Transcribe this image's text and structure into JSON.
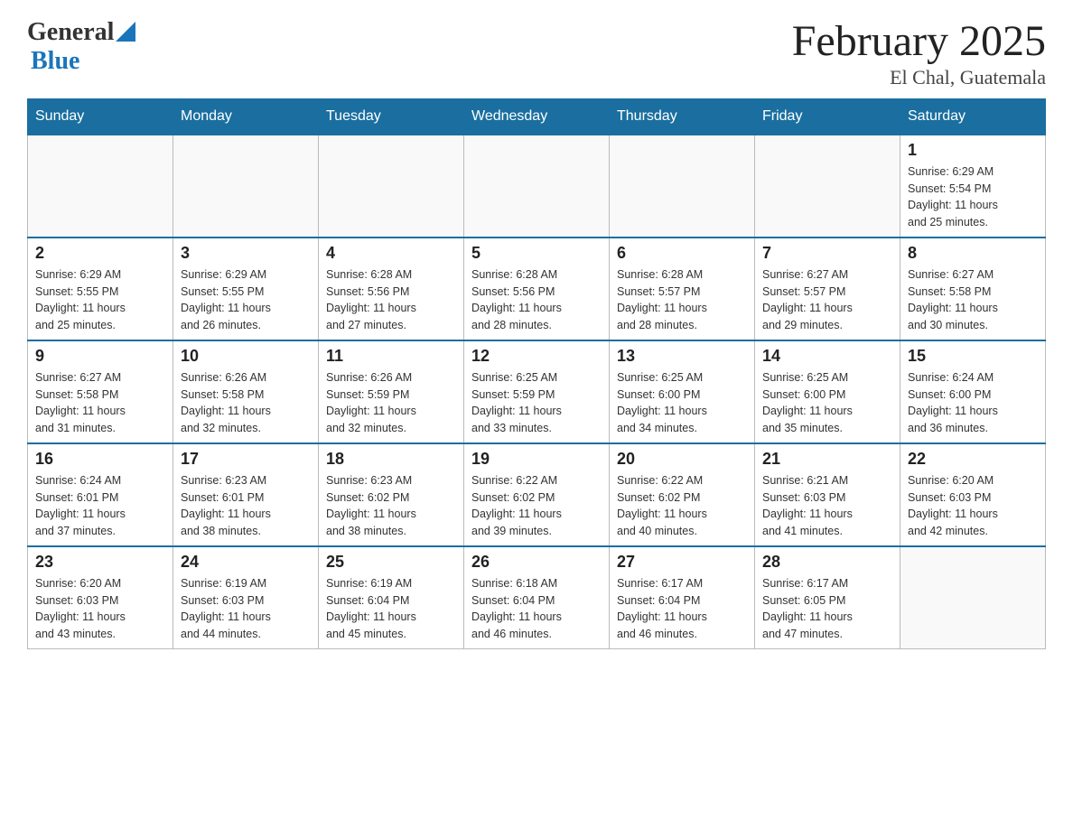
{
  "header": {
    "logo_general": "General",
    "logo_blue": "Blue",
    "month_title": "February 2025",
    "location": "El Chal, Guatemala"
  },
  "days_of_week": [
    "Sunday",
    "Monday",
    "Tuesday",
    "Wednesday",
    "Thursday",
    "Friday",
    "Saturday"
  ],
  "weeks": [
    [
      {
        "day": "",
        "info": ""
      },
      {
        "day": "",
        "info": ""
      },
      {
        "day": "",
        "info": ""
      },
      {
        "day": "",
        "info": ""
      },
      {
        "day": "",
        "info": ""
      },
      {
        "day": "",
        "info": ""
      },
      {
        "day": "1",
        "info": "Sunrise: 6:29 AM\nSunset: 5:54 PM\nDaylight: 11 hours\nand 25 minutes."
      }
    ],
    [
      {
        "day": "2",
        "info": "Sunrise: 6:29 AM\nSunset: 5:55 PM\nDaylight: 11 hours\nand 25 minutes."
      },
      {
        "day": "3",
        "info": "Sunrise: 6:29 AM\nSunset: 5:55 PM\nDaylight: 11 hours\nand 26 minutes."
      },
      {
        "day": "4",
        "info": "Sunrise: 6:28 AM\nSunset: 5:56 PM\nDaylight: 11 hours\nand 27 minutes."
      },
      {
        "day": "5",
        "info": "Sunrise: 6:28 AM\nSunset: 5:56 PM\nDaylight: 11 hours\nand 28 minutes."
      },
      {
        "day": "6",
        "info": "Sunrise: 6:28 AM\nSunset: 5:57 PM\nDaylight: 11 hours\nand 28 minutes."
      },
      {
        "day": "7",
        "info": "Sunrise: 6:27 AM\nSunset: 5:57 PM\nDaylight: 11 hours\nand 29 minutes."
      },
      {
        "day": "8",
        "info": "Sunrise: 6:27 AM\nSunset: 5:58 PM\nDaylight: 11 hours\nand 30 minutes."
      }
    ],
    [
      {
        "day": "9",
        "info": "Sunrise: 6:27 AM\nSunset: 5:58 PM\nDaylight: 11 hours\nand 31 minutes."
      },
      {
        "day": "10",
        "info": "Sunrise: 6:26 AM\nSunset: 5:58 PM\nDaylight: 11 hours\nand 32 minutes."
      },
      {
        "day": "11",
        "info": "Sunrise: 6:26 AM\nSunset: 5:59 PM\nDaylight: 11 hours\nand 32 minutes."
      },
      {
        "day": "12",
        "info": "Sunrise: 6:25 AM\nSunset: 5:59 PM\nDaylight: 11 hours\nand 33 minutes."
      },
      {
        "day": "13",
        "info": "Sunrise: 6:25 AM\nSunset: 6:00 PM\nDaylight: 11 hours\nand 34 minutes."
      },
      {
        "day": "14",
        "info": "Sunrise: 6:25 AM\nSunset: 6:00 PM\nDaylight: 11 hours\nand 35 minutes."
      },
      {
        "day": "15",
        "info": "Sunrise: 6:24 AM\nSunset: 6:00 PM\nDaylight: 11 hours\nand 36 minutes."
      }
    ],
    [
      {
        "day": "16",
        "info": "Sunrise: 6:24 AM\nSunset: 6:01 PM\nDaylight: 11 hours\nand 37 minutes."
      },
      {
        "day": "17",
        "info": "Sunrise: 6:23 AM\nSunset: 6:01 PM\nDaylight: 11 hours\nand 38 minutes."
      },
      {
        "day": "18",
        "info": "Sunrise: 6:23 AM\nSunset: 6:02 PM\nDaylight: 11 hours\nand 38 minutes."
      },
      {
        "day": "19",
        "info": "Sunrise: 6:22 AM\nSunset: 6:02 PM\nDaylight: 11 hours\nand 39 minutes."
      },
      {
        "day": "20",
        "info": "Sunrise: 6:22 AM\nSunset: 6:02 PM\nDaylight: 11 hours\nand 40 minutes."
      },
      {
        "day": "21",
        "info": "Sunrise: 6:21 AM\nSunset: 6:03 PM\nDaylight: 11 hours\nand 41 minutes."
      },
      {
        "day": "22",
        "info": "Sunrise: 6:20 AM\nSunset: 6:03 PM\nDaylight: 11 hours\nand 42 minutes."
      }
    ],
    [
      {
        "day": "23",
        "info": "Sunrise: 6:20 AM\nSunset: 6:03 PM\nDaylight: 11 hours\nand 43 minutes."
      },
      {
        "day": "24",
        "info": "Sunrise: 6:19 AM\nSunset: 6:03 PM\nDaylight: 11 hours\nand 44 minutes."
      },
      {
        "day": "25",
        "info": "Sunrise: 6:19 AM\nSunset: 6:04 PM\nDaylight: 11 hours\nand 45 minutes."
      },
      {
        "day": "26",
        "info": "Sunrise: 6:18 AM\nSunset: 6:04 PM\nDaylight: 11 hours\nand 46 minutes."
      },
      {
        "day": "27",
        "info": "Sunrise: 6:17 AM\nSunset: 6:04 PM\nDaylight: 11 hours\nand 46 minutes."
      },
      {
        "day": "28",
        "info": "Sunrise: 6:17 AM\nSunset: 6:05 PM\nDaylight: 11 hours\nand 47 minutes."
      },
      {
        "day": "",
        "info": ""
      }
    ]
  ]
}
